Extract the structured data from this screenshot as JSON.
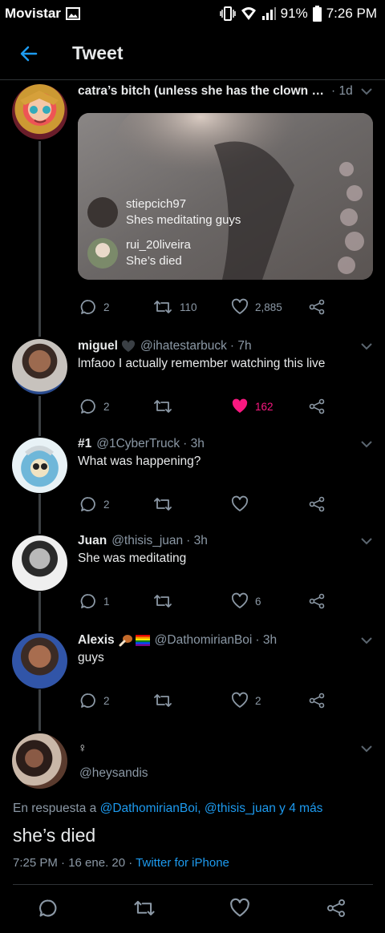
{
  "status_bar": {
    "carrier": "Movistar",
    "battery": "91%",
    "time": "7:26 PM"
  },
  "header": {
    "title": "Tweet"
  },
  "tweets": [
    {
      "name": "catra’s bitch (unless she has the clown m…",
      "handle": "",
      "time": "· 1d",
      "text": "",
      "media_comments": [
        {
          "user": "stiepcich97",
          "text": "Shes meditating guys"
        },
        {
          "user": "rui_20liveira",
          "text": "She’s died"
        }
      ],
      "replies": "2",
      "retweets": "110",
      "likes": "2,885",
      "liked": false
    },
    {
      "name": "miguel",
      "handle": "@ihatestarbuck",
      "time": "· 7h",
      "text": "lmfaoo I actually remember watching this live",
      "replies": "2",
      "retweets": "",
      "likes": "162",
      "liked": true
    },
    {
      "name": "#1",
      "handle": "@1CyberTruck",
      "time": "· 3h",
      "text": "What was happening?",
      "replies": "2",
      "retweets": "",
      "likes": "",
      "liked": false
    },
    {
      "name": "Juan",
      "handle": "@thisis_juan",
      "time": "· 3h",
      "text": "She was meditating",
      "replies": "1",
      "retweets": "",
      "likes": "6",
      "liked": false
    },
    {
      "name": "Alexis",
      "handle": "@DathomirianBoi",
      "time": "· 3h",
      "text": "guys",
      "replies": "2",
      "retweets": "",
      "likes": "2",
      "liked": false
    }
  ],
  "focal": {
    "name": "♀",
    "handle": "@heysandis",
    "reply_prefix": "En respuesta a ",
    "reply_users": "@DathomirianBoi, @thisis_juan y 4 más",
    "text": "she’s died",
    "timestamp": "7:25 PM · 16 ene. 20 · ",
    "client": "Twitter for iPhone"
  },
  "colors": {
    "background": "#000000",
    "accent": "#1d9bf0",
    "like": "#f91880",
    "muted": "#8b98a5"
  }
}
